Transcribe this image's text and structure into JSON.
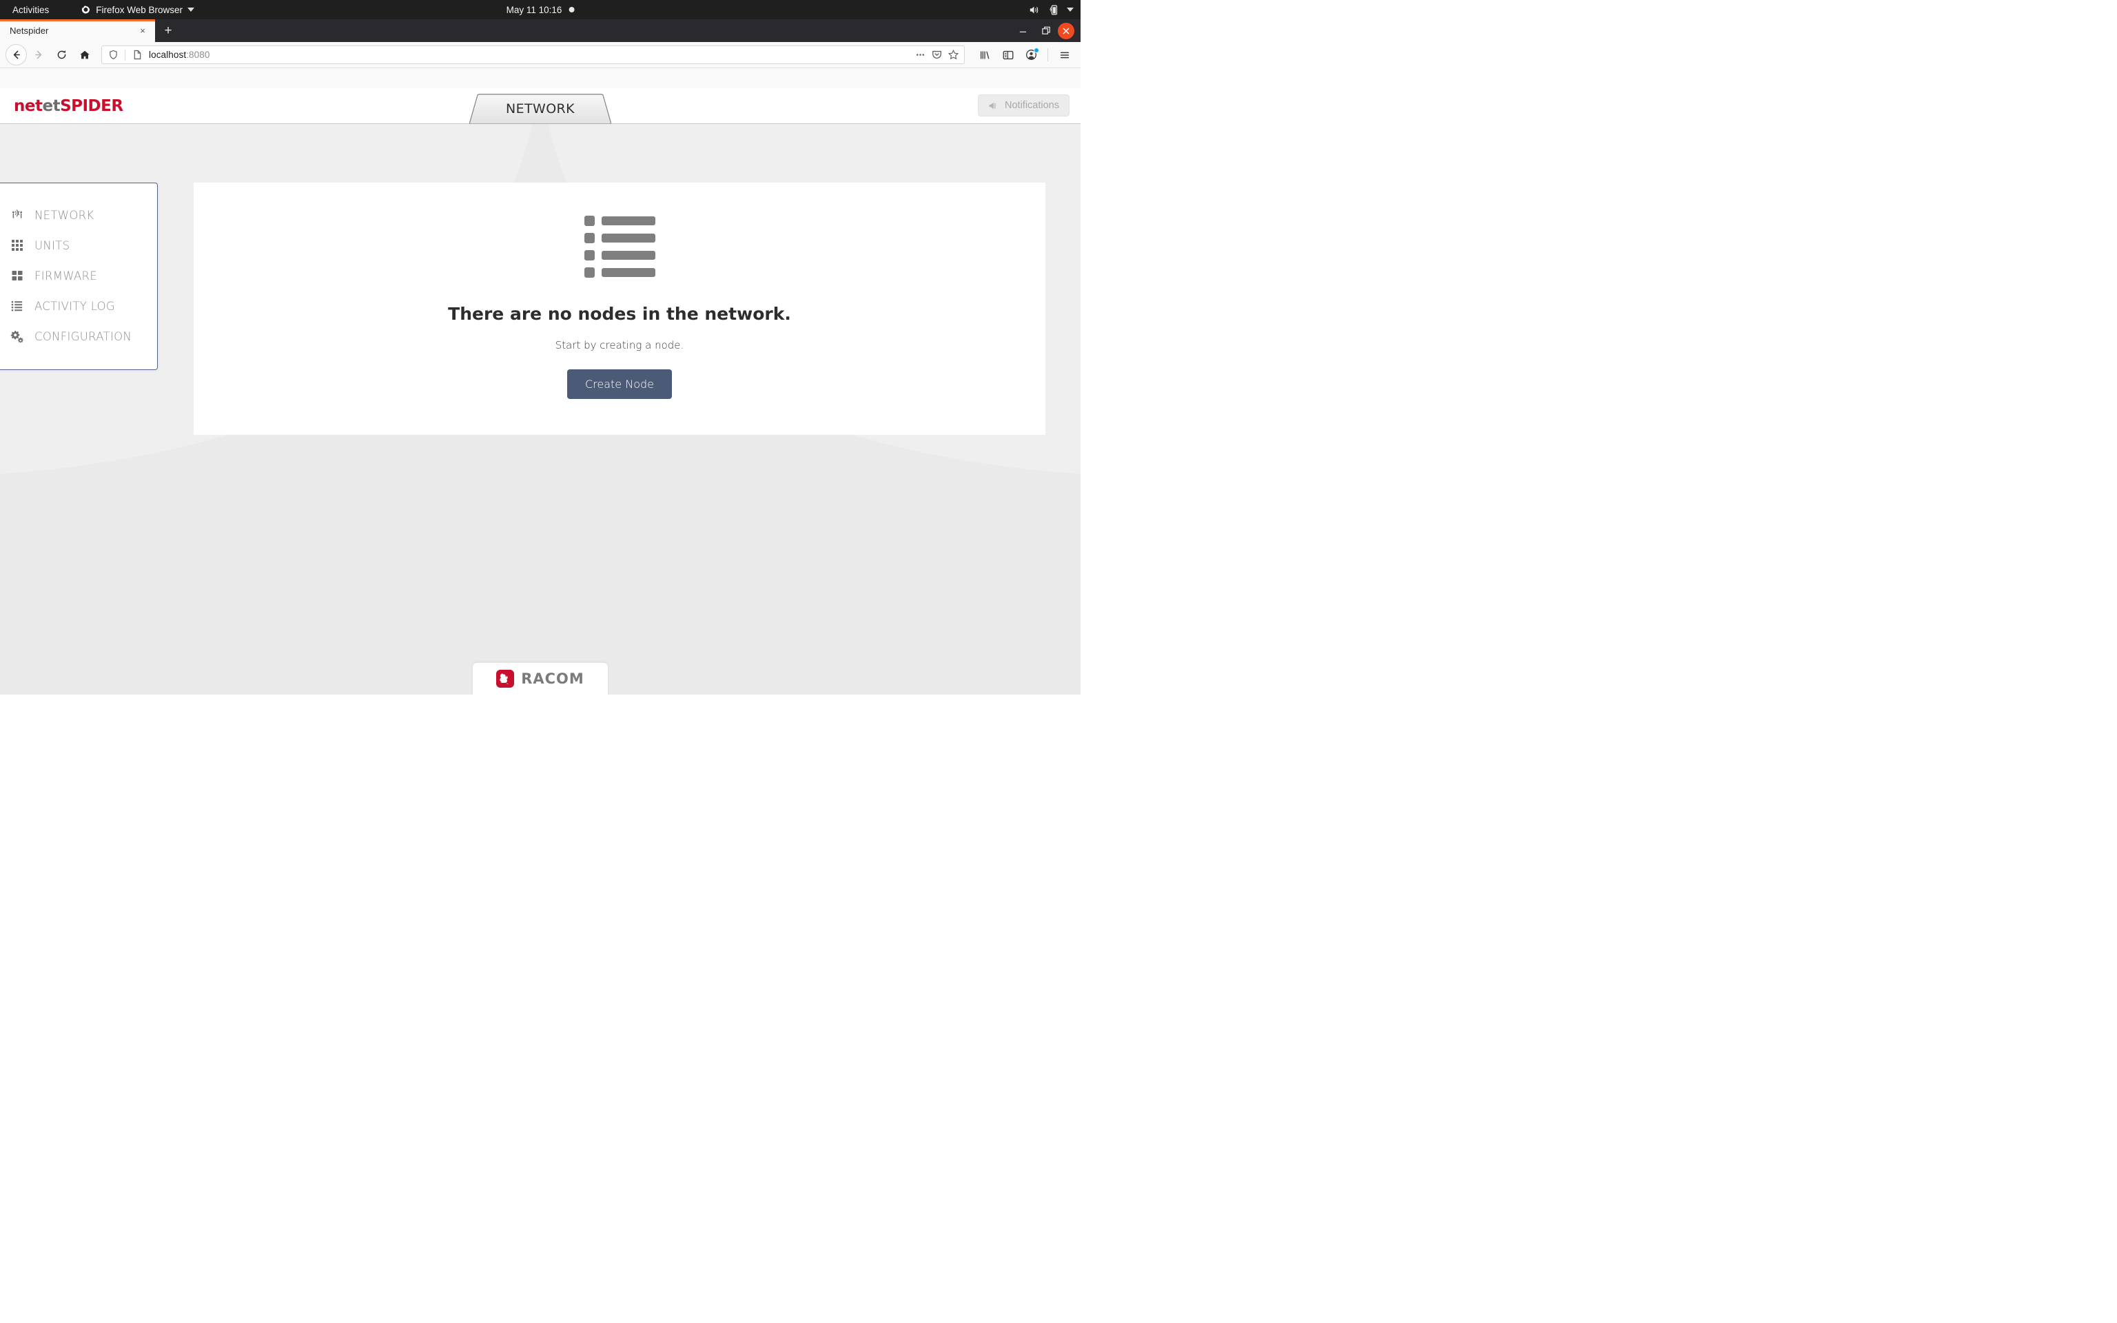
{
  "os_bar": {
    "activities": "Activities",
    "app_name": "Firefox Web Browser",
    "app_icon": "firefox-icon",
    "clock": "May 11  10:16",
    "recording_dot": "recording-indicator",
    "tray": [
      "volume-icon",
      "battery-charging-icon",
      "system-menu-caret-icon"
    ]
  },
  "browser": {
    "tab": {
      "title": "Netspider",
      "close_label": "×"
    },
    "new_tab_label": "+",
    "window_controls": {
      "minimize": "–",
      "restore": "restore",
      "close": "×"
    },
    "nav": {
      "back": "back-arrow",
      "forward": "forward-arrow",
      "reload": "reload",
      "home": "home"
    },
    "url": {
      "host": "localhost",
      "port": ":8080",
      "shield_icon": "tracking-protection-shield",
      "page_icon": "page-document-icon"
    },
    "url_actions": [
      "page-actions-ellipsis",
      "pocket-save",
      "bookmark-star"
    ],
    "toolbar_right": [
      "library-icon",
      "sidebar-toggle-icon",
      "account-icon",
      "app-menu-icon"
    ]
  },
  "app": {
    "brand": {
      "part1": "net",
      "part2": "et",
      "part3": "SPIDER",
      "red": "#c8102e",
      "gray": "#6e6e6e"
    },
    "active_tab": "NETWORK",
    "notifications": {
      "label": "Notifications",
      "icon": "megaphone-icon"
    },
    "sidebar": {
      "items": [
        {
          "label": "NETWORK",
          "icon": "antenna-network-icon"
        },
        {
          "label": "UNITS",
          "icon": "grid-3x3-icon"
        },
        {
          "label": "FIRMWARE",
          "icon": "grid-2x2-icon"
        },
        {
          "label": "ACTIVITY LOG",
          "icon": "list-icon"
        },
        {
          "label": "CONFIGURATION",
          "icon": "gears-icon"
        }
      ]
    },
    "empty_state": {
      "placeholder_icon": "list-placeholder-icon",
      "title": "There are no nodes in the network.",
      "subtitle": "Start by creating a node.",
      "button_label": "Create Node",
      "button_color": "#4a5a77"
    },
    "footer": {
      "logo_text": "RACOM",
      "logo_mark": "racom-squirrel-icon",
      "mark_color": "#c8102e"
    }
  }
}
